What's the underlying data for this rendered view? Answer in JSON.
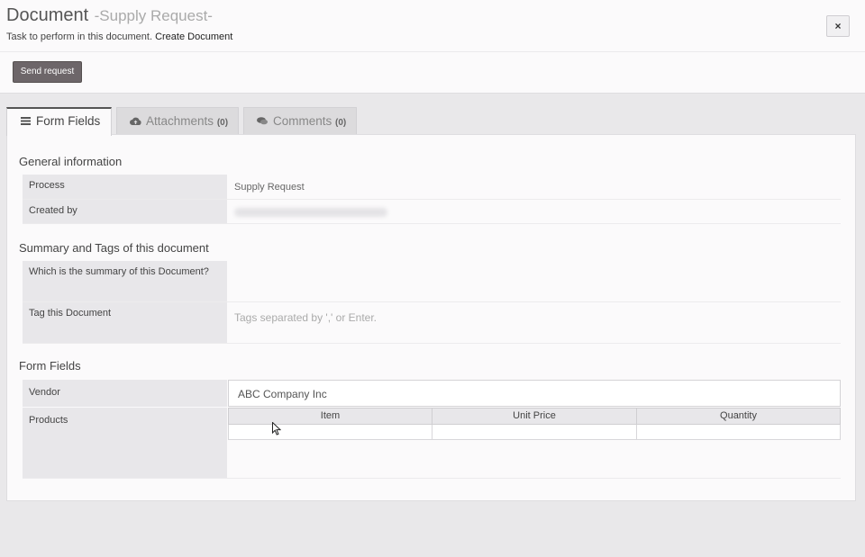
{
  "header": {
    "title": "Document",
    "subtitle": "-Supply Request-",
    "task_prefix": "Task to perform in this document.",
    "task_name": "Create Document",
    "close_label": "×",
    "send_label": "Send request"
  },
  "tabs": [
    {
      "label": "Form Fields",
      "count": "",
      "icon": "list-icon"
    },
    {
      "label": "Attachments",
      "count": "(0)",
      "icon": "cloud-upload-icon"
    },
    {
      "label": "Comments",
      "count": "(0)",
      "icon": "comments-icon"
    }
  ],
  "general": {
    "title": "General information",
    "process_label": "Process",
    "process_value": "Supply Request",
    "created_label": "Created by"
  },
  "summary": {
    "title": "Summary and Tags of this document",
    "summary_label": "Which is the summary of this Document?",
    "tag_label": "Tag this Document",
    "tag_placeholder": "Tags separated by ',' or Enter."
  },
  "form": {
    "title": "Form Fields",
    "vendor_label": "Vendor",
    "vendor_value": "ABC Company Inc",
    "products_label": "Products",
    "columns": [
      "Item",
      "Unit Price",
      "Quantity"
    ]
  }
}
